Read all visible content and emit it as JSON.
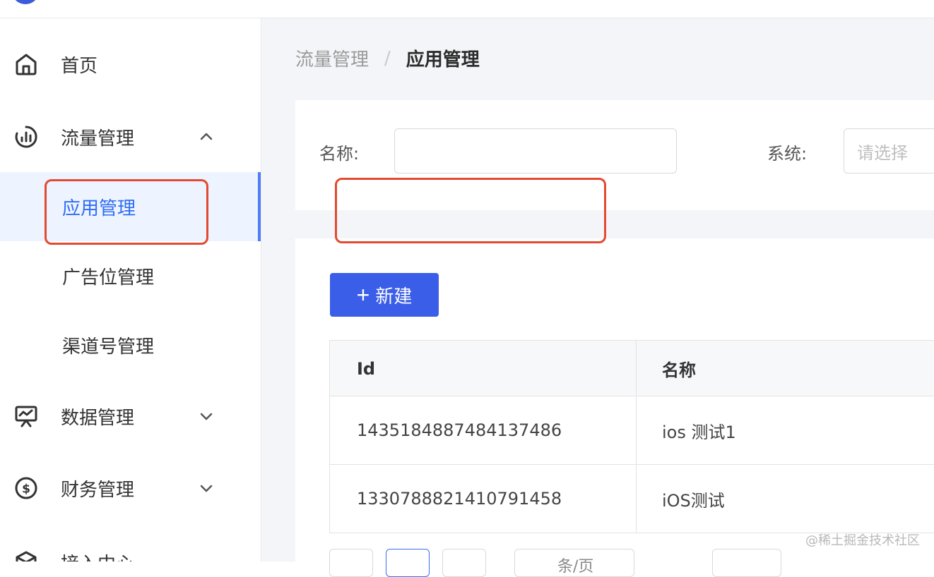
{
  "sidebar": {
    "items": [
      {
        "label": "首页",
        "icon": "home-icon"
      },
      {
        "label": "流量管理",
        "icon": "traffic-icon",
        "expanded": true,
        "children": [
          {
            "label": "应用管理",
            "active": true
          },
          {
            "label": "广告位管理"
          },
          {
            "label": "渠道号管理"
          }
        ]
      },
      {
        "label": "数据管理",
        "icon": "data-monitor-icon"
      },
      {
        "label": "财务管理",
        "icon": "dollar-icon"
      },
      {
        "label": "接入中心",
        "icon": "box-icon"
      }
    ]
  },
  "breadcrumb": {
    "parent": "流量管理",
    "separator": "/",
    "current": "应用管理"
  },
  "filters": {
    "name_label": "名称:",
    "name_value": "",
    "system_label": "系统:",
    "system_placeholder": "请选择"
  },
  "toolbar": {
    "new_icon": "+",
    "new_label": "新建"
  },
  "table": {
    "columns": [
      "Id",
      "名称"
    ],
    "rows": [
      {
        "id": "1435184887484137486",
        "name": "ios 测试1"
      },
      {
        "id": "1330788821410791458",
        "name": "iOS测试"
      }
    ]
  },
  "pager": {
    "page_size_partial": "条/页"
  },
  "watermark": "@稀土掘金技术社区",
  "colors": {
    "primary": "#3b5ee8",
    "active_text": "#2f6df6",
    "highlight": "#e34a2f"
  }
}
